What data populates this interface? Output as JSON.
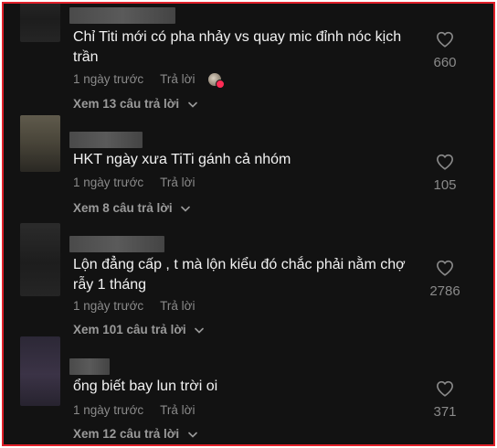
{
  "comments": [
    {
      "text": "Chỉ Titi mới có pha nhảy vs quay mic đỉnh nóc kịch trần",
      "time": "1 ngày trước",
      "reply_label": "Trả lời",
      "view_replies": "Xem 13 câu trả lời",
      "likes": "660",
      "creator_liked": true
    },
    {
      "text": "HKT ngày xưa TiTi gánh cả nhóm",
      "time": "1 ngày trước",
      "reply_label": "Trả lời",
      "view_replies": "Xem 8 câu trả lời",
      "likes": "105"
    },
    {
      "text": "Lộn đẳng cấp , t mà lộn kiểu đó chắc phải nằm chợ rẫy 1 tháng",
      "time": "1 ngày trước",
      "reply_label": "Trả lời",
      "view_replies": "Xem 101 câu trả lời",
      "likes": "2786"
    },
    {
      "text": "ổng biết bay lun trời oi",
      "time": "1 ngày trước",
      "reply_label": "Trả lời",
      "view_replies": "Xem 12 câu trả lời",
      "likes": "371"
    }
  ],
  "colors": {
    "background": "#121212",
    "border": "#e0202a",
    "text": "#f2f2f2",
    "muted": "#8a8a8a",
    "badge": "#fe2c55"
  },
  "icons": [
    "heart-outline-icon",
    "chevron-down-icon",
    "creator-liked-avatar-icon"
  ]
}
